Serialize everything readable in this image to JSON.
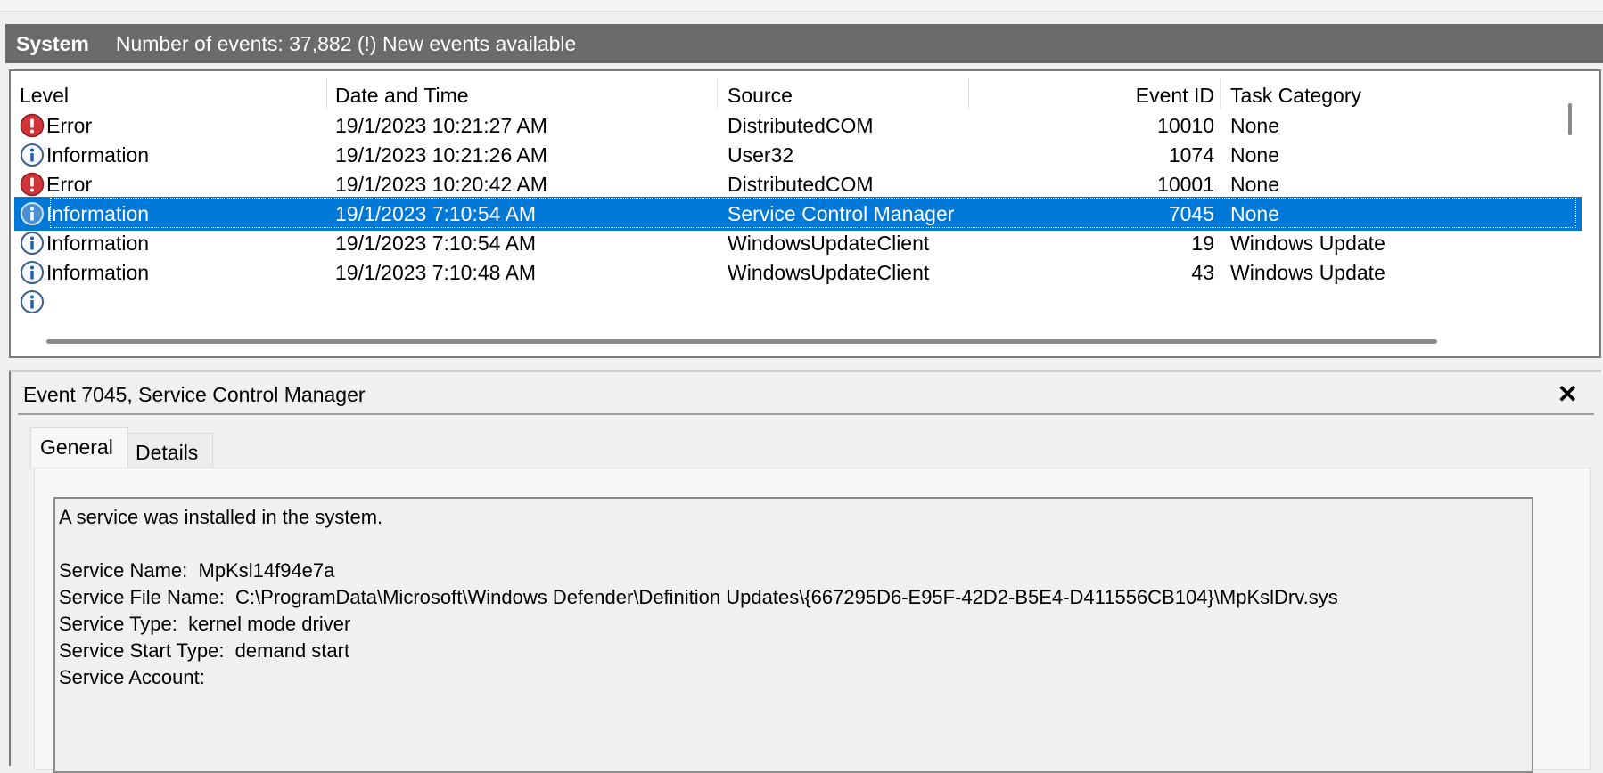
{
  "header": {
    "log_name": "System",
    "event_count_text": "Number of events: 37,882 (!) New events available"
  },
  "columns": {
    "level": "Level",
    "datetime": "Date and Time",
    "source": "Source",
    "event_id": "Event ID",
    "task_category": "Task Category"
  },
  "events": [
    {
      "level": "Error",
      "level_icon": "error-icon",
      "datetime": "19/1/2023 10:21:27 AM",
      "source": "DistributedCOM",
      "event_id": "10010",
      "task_category": "None",
      "selected": false
    },
    {
      "level": "Information",
      "level_icon": "info-icon",
      "datetime": "19/1/2023 10:21:26 AM",
      "source": "User32",
      "event_id": "1074",
      "task_category": "None",
      "selected": false
    },
    {
      "level": "Error",
      "level_icon": "error-icon",
      "datetime": "19/1/2023 10:20:42 AM",
      "source": "DistributedCOM",
      "event_id": "10001",
      "task_category": "None",
      "selected": false
    },
    {
      "level": "Information",
      "level_icon": "info-icon",
      "datetime": "19/1/2023 7:10:54 AM",
      "source": "Service Control Manager",
      "event_id": "7045",
      "task_category": "None",
      "selected": true
    },
    {
      "level": "Information",
      "level_icon": "info-icon",
      "datetime": "19/1/2023 7:10:54 AM",
      "source": "WindowsUpdateClient",
      "event_id": "19",
      "task_category": "Windows Update",
      "selected": false
    },
    {
      "level": "Information",
      "level_icon": "info-icon",
      "datetime": "19/1/2023 7:10:48 AM",
      "source": "WindowsUpdateClient",
      "event_id": "43",
      "task_category": "Windows Update",
      "selected": false
    }
  ],
  "detail": {
    "title": "Event 7045, Service Control Manager",
    "close_icon": "close-icon",
    "tabs": [
      "General",
      "Details"
    ],
    "message": {
      "intro": "A service was installed in the system.",
      "service_name": "Service Name:  MpKsl14f94e7a",
      "service_file_name": "Service File Name:  C:\\ProgramData\\Microsoft\\Windows Defender\\Definition Updates\\{667295D6-E95F-42D2-B5E4-D411556CB104}\\MpKslDrv.sys",
      "service_type": "Service Type:  kernel mode driver",
      "service_start_type": "Service Start Type:  demand start",
      "service_account": "Service Account:"
    }
  },
  "colors": {
    "selection": "#0078d7",
    "error_red": "#d13438",
    "info_blue": "#1f5fb0",
    "header_bar": "#6b6b6b"
  }
}
